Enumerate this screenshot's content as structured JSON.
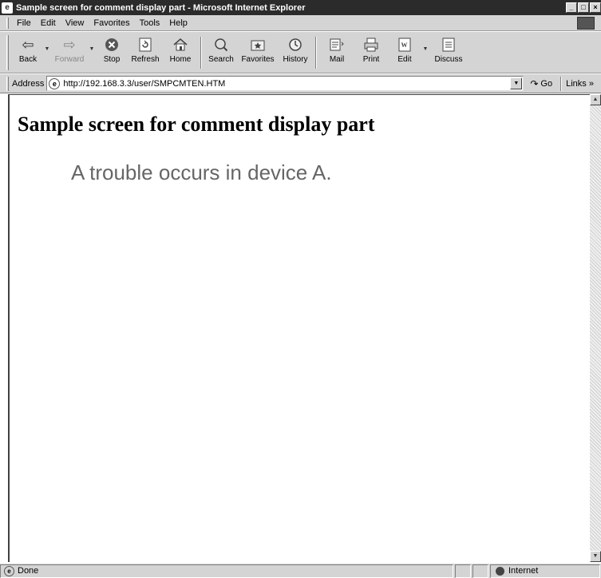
{
  "window": {
    "title": "Sample screen for comment display part - Microsoft Internet Explorer",
    "icon": "ie-page-icon"
  },
  "menu": [
    {
      "label": "File",
      "key": "F"
    },
    {
      "label": "Edit",
      "key": "E"
    },
    {
      "label": "View",
      "key": "V"
    },
    {
      "label": "Favorites",
      "key": "a"
    },
    {
      "label": "Tools",
      "key": "T"
    },
    {
      "label": "Help",
      "key": "H"
    }
  ],
  "toolbar": {
    "back": "Back",
    "forward": "Forward",
    "stop": "Stop",
    "refresh": "Refresh",
    "home": "Home",
    "search": "Search",
    "favorites": "Favorites",
    "history": "History",
    "mail": "Mail",
    "print": "Print",
    "edit": "Edit",
    "discuss": "Discuss"
  },
  "address": {
    "label": "Address",
    "url": "http://192.168.3.3/user/SMPCMTEN.HTM",
    "go": "Go",
    "links": "Links »"
  },
  "page": {
    "heading": "Sample screen for comment display part",
    "comment": "A trouble occurs in device A."
  },
  "status": {
    "text": "Done",
    "zone": "Internet"
  }
}
